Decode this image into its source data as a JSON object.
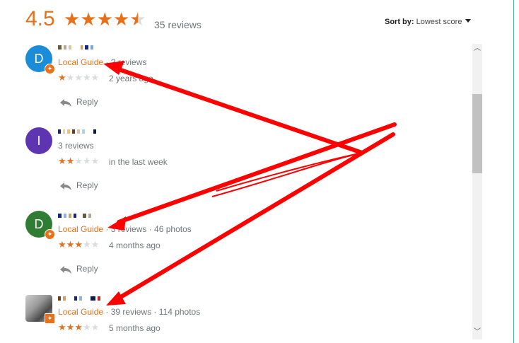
{
  "header": {
    "rating": "4.5",
    "rating_value": 4.5,
    "review_count": "35 reviews",
    "sort_label": "Sort by:",
    "sort_value": "Lowest score"
  },
  "reviews": [
    {
      "avatar_letter": "D",
      "avatar_color": "#1a8cd8",
      "local_guide": true,
      "local_guide_label": "Local Guide",
      "stats": " · 2 reviews",
      "stars": 1,
      "when": "2 years ago",
      "reply": "Reply"
    },
    {
      "avatar_letter": "I",
      "avatar_color": "#5e35b1",
      "local_guide": false,
      "stats": "3 reviews",
      "stars": 2,
      "when": "in the last week",
      "reply": "Reply"
    },
    {
      "avatar_letter": "D",
      "avatar_color": "#2e7d32",
      "local_guide": true,
      "local_guide_label": "Local Guide",
      "stats": " · 3 reviews · 46 photos",
      "stars": 3,
      "when": "4 months ago",
      "reply": "Reply"
    },
    {
      "avatar_letter": "",
      "avatar_color": "#8a8a8a",
      "local_guide": true,
      "local_guide_label": "Local Guide",
      "stats": " · 39 reviews · 114 photos",
      "stars": 3,
      "when": "5 months ago"
    }
  ],
  "colors": {
    "accent": "#e7711b",
    "annotation": "#ff0000"
  },
  "icons": {
    "reply": "reply-arrow-icon",
    "scroll_up": "chevron-up-icon",
    "scroll_down": "chevron-down-icon"
  }
}
